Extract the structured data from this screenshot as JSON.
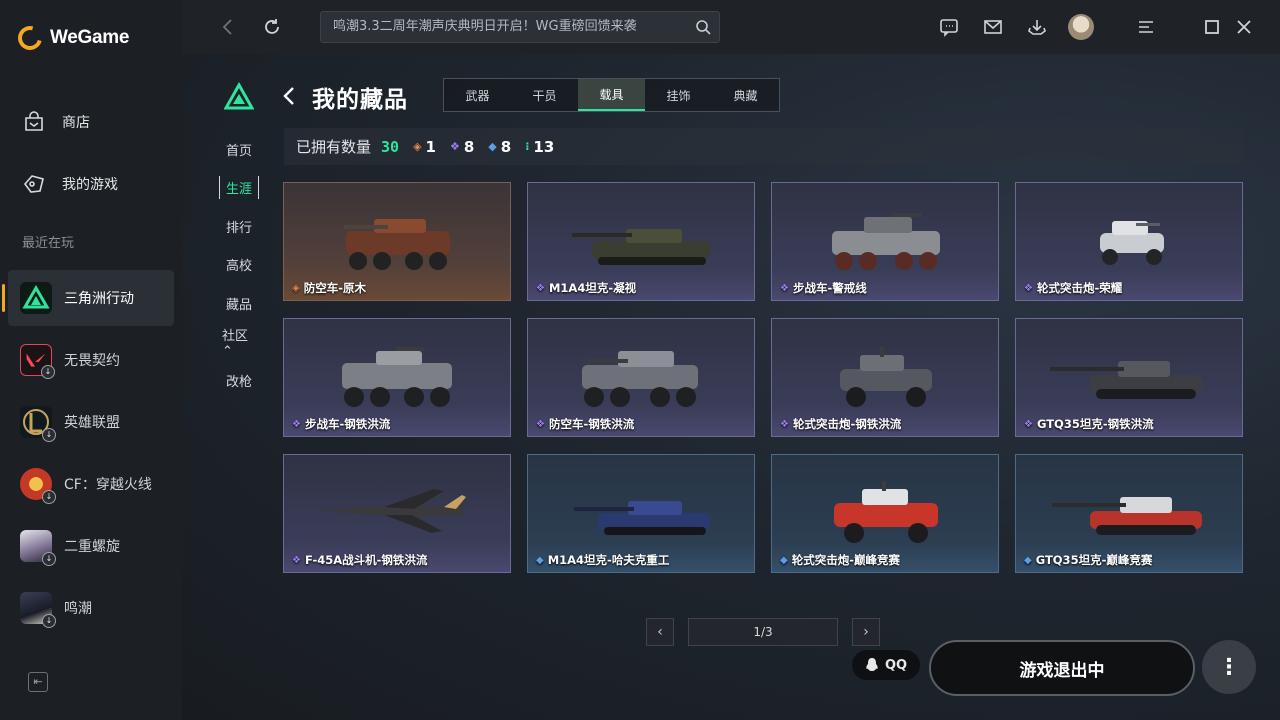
{
  "app": {
    "brand": "WeGame"
  },
  "sidebar": {
    "nav": [
      {
        "label": "商店",
        "icon": "store-bag-icon"
      },
      {
        "label": "我的游戏",
        "icon": "gamepad-icon"
      }
    ],
    "recent_label": "最近在玩",
    "games": [
      {
        "label": "三角洲行动",
        "icon": "delta-force-icon",
        "active": true
      },
      {
        "label": "无畏契约",
        "icon": "valorant-icon"
      },
      {
        "label": "英雄联盟",
        "icon": "league-of-legends-icon"
      },
      {
        "label": "CF：穿越火线",
        "icon": "crossfire-icon"
      },
      {
        "label": "二重螺旋",
        "icon": "duet-night-abyss-icon"
      },
      {
        "label": "鸣潮",
        "icon": "wuthering-waves-icon"
      }
    ]
  },
  "topbar": {
    "search_text": "鸣潮3.3二周年潮声庆典明日开启！WG重磅回馈来袭"
  },
  "game_menu": {
    "items": [
      {
        "label": "首页"
      },
      {
        "label": "生涯",
        "active": true
      },
      {
        "label": "排行"
      },
      {
        "label": "高校"
      },
      {
        "label": "藏品"
      },
      {
        "label": "社区⌃"
      },
      {
        "label": "改枪"
      }
    ]
  },
  "collection": {
    "title": "我的藏品",
    "tabs": [
      {
        "label": "武器"
      },
      {
        "label": "干员"
      },
      {
        "label": "载具",
        "active": true
      },
      {
        "label": "挂饰"
      },
      {
        "label": "典藏"
      }
    ],
    "owned_label": "已拥有数量",
    "owned_total": "30",
    "rarity_counts": [
      {
        "icon": "◈",
        "color": "#e8884a",
        "count": "1"
      },
      {
        "icon": "❖",
        "color": "#9a7df0",
        "count": "8"
      },
      {
        "icon": "◆",
        "color": "#5a9ee8",
        "count": "8"
      },
      {
        "icon": "⁝",
        "color": "#2ee59d",
        "count": "13"
      }
    ],
    "items": [
      {
        "name": "防空车-原木",
        "rarity": "orange"
      },
      {
        "name": "M1A4坦克-凝视",
        "rarity": "purple"
      },
      {
        "name": "步战车-警戒线",
        "rarity": "purple"
      },
      {
        "name": "轮式突击炮-荣耀",
        "rarity": "purple"
      },
      {
        "name": "步战车-钢铁洪流",
        "rarity": "purple"
      },
      {
        "name": "防空车-钢铁洪流",
        "rarity": "purple"
      },
      {
        "name": "轮式突击炮-钢铁洪流",
        "rarity": "purple"
      },
      {
        "name": "GTQ35坦克-钢铁洪流",
        "rarity": "purple"
      },
      {
        "name": "F-45A战斗机-钢铁洪流",
        "rarity": "purple"
      },
      {
        "name": "M1A4坦克-哈夫克重工",
        "rarity": "blue"
      },
      {
        "name": "轮式突击炮-巅峰竞赛",
        "rarity": "blue"
      },
      {
        "name": "GTQ35坦克-巅峰竞赛",
        "rarity": "blue"
      }
    ],
    "page": "1/3"
  },
  "footer": {
    "qq_label": "QQ",
    "exit_label": "游戏退出中",
    "more_label": "⋮"
  },
  "colors": {
    "accent": "#2ee59d",
    "brand": "#f5a623",
    "rarity_orange": "#e8884a",
    "rarity_purple": "#9a7df0",
    "rarity_blue": "#5a9ee8"
  }
}
